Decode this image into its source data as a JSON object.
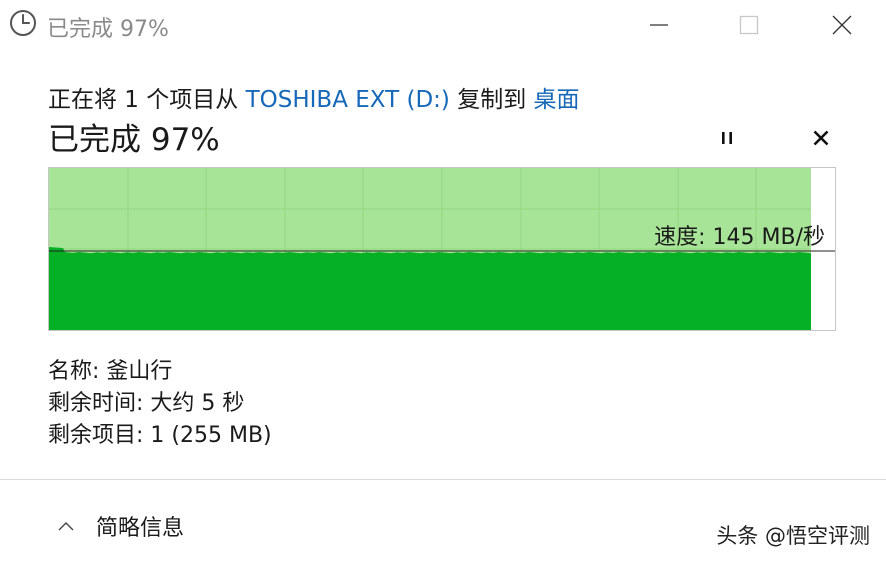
{
  "window": {
    "title": "已完成 97%",
    "icons": {
      "title": "clock-icon",
      "minimize": "minimize-icon",
      "maximize": "maximize-icon",
      "close": "close-icon"
    }
  },
  "header": {
    "copy_prefix": "正在将 1 个项目从 ",
    "source": "TOSHIBA EXT (D:)",
    "copy_middle": " 复制到 ",
    "destination": "桌面",
    "percent_title": "已完成 97%",
    "pause_icon": "pause-icon",
    "cancel_icon": "cancel-icon"
  },
  "progress": {
    "percent": 97,
    "speed_label": "速度: 145 MB/秒",
    "colors": {
      "done_fill": "#a8e497",
      "throughput_fill": "#06b025",
      "grid": "#93d67f",
      "speed_line": "#222222"
    }
  },
  "details": {
    "name": "名称: 釜山行",
    "time_remaining": "剩余时间: 大约 5 秒",
    "items_remaining": "剩余项目: 1 (255 MB)"
  },
  "footer": {
    "less_info_label": "简略信息",
    "chevron_icon": "chevron-up-icon",
    "watermark": "头条 @悟空评测"
  }
}
